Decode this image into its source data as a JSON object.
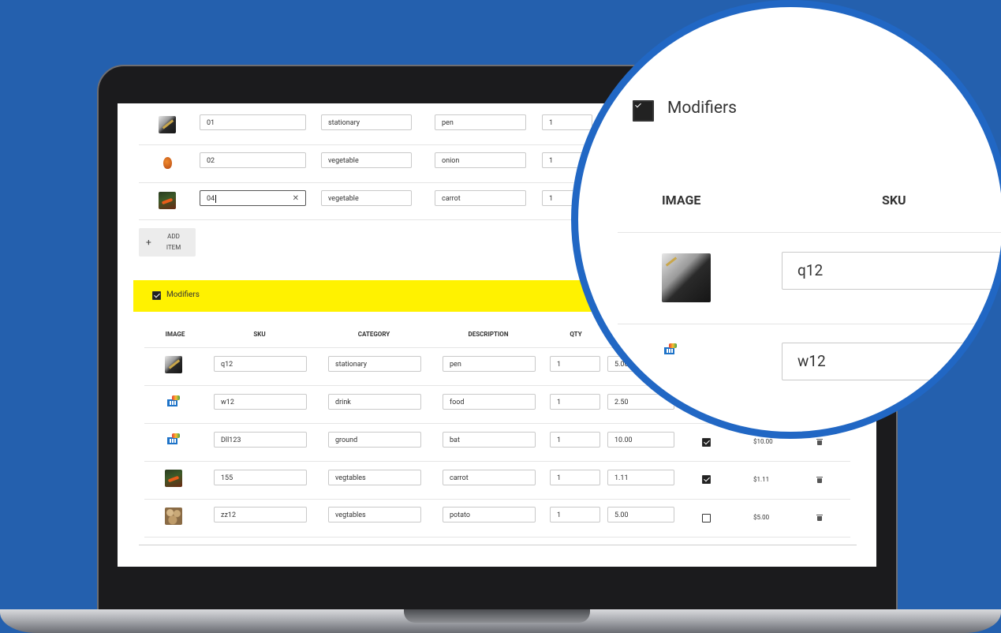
{
  "top_table": {
    "rows": [
      {
        "image": "pen-image",
        "sku": "01",
        "category": "stationary",
        "description": "pen",
        "qty": "1"
      },
      {
        "image": "onion-image",
        "sku": "02",
        "category": "vegetable",
        "description": "onion",
        "qty": "1"
      },
      {
        "image": "carrot-image",
        "sku": "04",
        "category": "vegetable",
        "description": "carrot",
        "qty": "1"
      }
    ],
    "clear_icon": "✕"
  },
  "add_item": {
    "icon": "+",
    "label_line1": "ADD",
    "label_line2": "ITEM"
  },
  "modifiers": {
    "label": "Modifiers",
    "checked": true,
    "bar_color": "#fff200",
    "columns": {
      "image": "IMAGE",
      "sku": "SKU",
      "category": "CATEGORY",
      "description": "DESCRIPTION",
      "qty": "QTY"
    },
    "rows": [
      {
        "image": "pen-image",
        "sku": "q12",
        "category": "stationary",
        "description": "pen",
        "qty": "1",
        "price": "5.00"
      },
      {
        "image": "cart-image",
        "sku": "w12",
        "category": "drink",
        "description": "food",
        "qty": "1",
        "price": "2.50"
      },
      {
        "image": "cart-image",
        "sku": "Dll123",
        "category": "ground",
        "description": "bat",
        "qty": "1",
        "price": "10.00",
        "checked": true,
        "total": "$10.00"
      },
      {
        "image": "carrot-image",
        "sku": "155",
        "category": "vegtables",
        "description": "carrot",
        "qty": "1",
        "price": "1.11",
        "checked": true,
        "total": "$1.11"
      },
      {
        "image": "potato-image",
        "sku": "zz12",
        "category": "vegtables",
        "description": "potato",
        "qty": "1",
        "price": "5.00",
        "checked": false,
        "total": "$5.00"
      }
    ]
  },
  "zoom": {
    "label": "Modifiers",
    "col_image": "IMAGE",
    "col_sku": "SKU",
    "sku1": "q12",
    "sku2": "w12"
  },
  "colors": {
    "background": "#2460ae",
    "lens_border": "#2167c4",
    "highlight": "#fff200"
  }
}
